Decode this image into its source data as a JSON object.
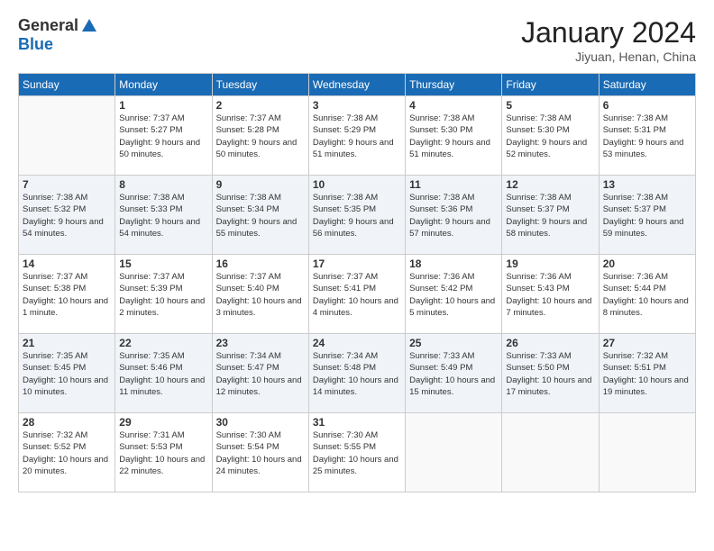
{
  "header": {
    "logo_general": "General",
    "logo_blue": "Blue",
    "title": "January 2024",
    "subtitle": "Jiyuan, Henan, China"
  },
  "days_of_week": [
    "Sunday",
    "Monday",
    "Tuesday",
    "Wednesday",
    "Thursday",
    "Friday",
    "Saturday"
  ],
  "weeks": [
    [
      {
        "day": "",
        "sunrise": "",
        "sunset": "",
        "daylight": ""
      },
      {
        "day": "1",
        "sunrise": "7:37 AM",
        "sunset": "5:27 PM",
        "daylight": "9 hours and 50 minutes."
      },
      {
        "day": "2",
        "sunrise": "7:37 AM",
        "sunset": "5:28 PM",
        "daylight": "9 hours and 50 minutes."
      },
      {
        "day": "3",
        "sunrise": "7:38 AM",
        "sunset": "5:29 PM",
        "daylight": "9 hours and 51 minutes."
      },
      {
        "day": "4",
        "sunrise": "7:38 AM",
        "sunset": "5:30 PM",
        "daylight": "9 hours and 51 minutes."
      },
      {
        "day": "5",
        "sunrise": "7:38 AM",
        "sunset": "5:30 PM",
        "daylight": "9 hours and 52 minutes."
      },
      {
        "day": "6",
        "sunrise": "7:38 AM",
        "sunset": "5:31 PM",
        "daylight": "9 hours and 53 minutes."
      }
    ],
    [
      {
        "day": "7",
        "sunrise": "7:38 AM",
        "sunset": "5:32 PM",
        "daylight": "9 hours and 54 minutes."
      },
      {
        "day": "8",
        "sunrise": "7:38 AM",
        "sunset": "5:33 PM",
        "daylight": "9 hours and 54 minutes."
      },
      {
        "day": "9",
        "sunrise": "7:38 AM",
        "sunset": "5:34 PM",
        "daylight": "9 hours and 55 minutes."
      },
      {
        "day": "10",
        "sunrise": "7:38 AM",
        "sunset": "5:35 PM",
        "daylight": "9 hours and 56 minutes."
      },
      {
        "day": "11",
        "sunrise": "7:38 AM",
        "sunset": "5:36 PM",
        "daylight": "9 hours and 57 minutes."
      },
      {
        "day": "12",
        "sunrise": "7:38 AM",
        "sunset": "5:37 PM",
        "daylight": "9 hours and 58 minutes."
      },
      {
        "day": "13",
        "sunrise": "7:38 AM",
        "sunset": "5:37 PM",
        "daylight": "9 hours and 59 minutes."
      }
    ],
    [
      {
        "day": "14",
        "sunrise": "7:37 AM",
        "sunset": "5:38 PM",
        "daylight": "10 hours and 1 minute."
      },
      {
        "day": "15",
        "sunrise": "7:37 AM",
        "sunset": "5:39 PM",
        "daylight": "10 hours and 2 minutes."
      },
      {
        "day": "16",
        "sunrise": "7:37 AM",
        "sunset": "5:40 PM",
        "daylight": "10 hours and 3 minutes."
      },
      {
        "day": "17",
        "sunrise": "7:37 AM",
        "sunset": "5:41 PM",
        "daylight": "10 hours and 4 minutes."
      },
      {
        "day": "18",
        "sunrise": "7:36 AM",
        "sunset": "5:42 PM",
        "daylight": "10 hours and 5 minutes."
      },
      {
        "day": "19",
        "sunrise": "7:36 AM",
        "sunset": "5:43 PM",
        "daylight": "10 hours and 7 minutes."
      },
      {
        "day": "20",
        "sunrise": "7:36 AM",
        "sunset": "5:44 PM",
        "daylight": "10 hours and 8 minutes."
      }
    ],
    [
      {
        "day": "21",
        "sunrise": "7:35 AM",
        "sunset": "5:45 PM",
        "daylight": "10 hours and 10 minutes."
      },
      {
        "day": "22",
        "sunrise": "7:35 AM",
        "sunset": "5:46 PM",
        "daylight": "10 hours and 11 minutes."
      },
      {
        "day": "23",
        "sunrise": "7:34 AM",
        "sunset": "5:47 PM",
        "daylight": "10 hours and 12 minutes."
      },
      {
        "day": "24",
        "sunrise": "7:34 AM",
        "sunset": "5:48 PM",
        "daylight": "10 hours and 14 minutes."
      },
      {
        "day": "25",
        "sunrise": "7:33 AM",
        "sunset": "5:49 PM",
        "daylight": "10 hours and 15 minutes."
      },
      {
        "day": "26",
        "sunrise": "7:33 AM",
        "sunset": "5:50 PM",
        "daylight": "10 hours and 17 minutes."
      },
      {
        "day": "27",
        "sunrise": "7:32 AM",
        "sunset": "5:51 PM",
        "daylight": "10 hours and 19 minutes."
      }
    ],
    [
      {
        "day": "28",
        "sunrise": "7:32 AM",
        "sunset": "5:52 PM",
        "daylight": "10 hours and 20 minutes."
      },
      {
        "day": "29",
        "sunrise": "7:31 AM",
        "sunset": "5:53 PM",
        "daylight": "10 hours and 22 minutes."
      },
      {
        "day": "30",
        "sunrise": "7:30 AM",
        "sunset": "5:54 PM",
        "daylight": "10 hours and 24 minutes."
      },
      {
        "day": "31",
        "sunrise": "7:30 AM",
        "sunset": "5:55 PM",
        "daylight": "10 hours and 25 minutes."
      },
      {
        "day": "",
        "sunrise": "",
        "sunset": "",
        "daylight": ""
      },
      {
        "day": "",
        "sunrise": "",
        "sunset": "",
        "daylight": ""
      },
      {
        "day": "",
        "sunrise": "",
        "sunset": "",
        "daylight": ""
      }
    ]
  ]
}
